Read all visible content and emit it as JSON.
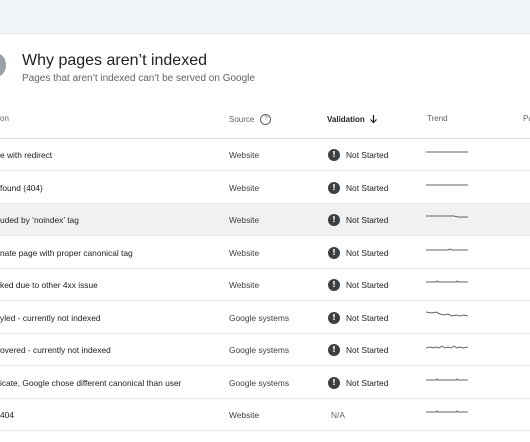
{
  "header": {
    "title": "Why pages aren’t indexed",
    "subtitle": "Pages that aren’t indexed can’t be served on Google"
  },
  "table": {
    "columns": {
      "reason": "on",
      "source": "Source",
      "validation": "Validation",
      "trend": "Trend",
      "pages": "Pa"
    },
    "rows": [
      {
        "reason": "e with redirect",
        "source": "Website",
        "validation": "Not Started",
        "validation_icon": "warning-icon",
        "trend_shape": "flat"
      },
      {
        "reason": "found (404)",
        "source": "Website",
        "validation": "Not Started",
        "validation_icon": "warning-icon",
        "trend_shape": "flat"
      },
      {
        "reason": "uded by ‘noindex’ tag",
        "source": "Website",
        "validation": "Not Started",
        "validation_icon": "warning-icon",
        "trend_shape": "slight-drop",
        "highlighted": true
      },
      {
        "reason": "nate page with proper canonical tag",
        "source": "Website",
        "validation": "Not Started",
        "validation_icon": "warning-icon",
        "trend_shape": "flat-blip"
      },
      {
        "reason": "ked due to other 4xx issue",
        "source": "Website",
        "validation": "Not Started",
        "validation_icon": "warning-icon",
        "trend_shape": "flat-ticks"
      },
      {
        "reason": "yled - currently not indexed",
        "source": "Google systems",
        "validation": "Not Started",
        "validation_icon": "warning-icon",
        "trend_shape": "declining"
      },
      {
        "reason": "overed - currently not indexed",
        "source": "Google systems",
        "validation": "Not Started",
        "validation_icon": "warning-icon",
        "trend_shape": "noisy"
      },
      {
        "reason": "icate, Google chose different canonical than user",
        "source": "Google systems",
        "validation": "Not Started",
        "validation_icon": "warning-icon",
        "trend_shape": "flat-ticks"
      },
      {
        "reason": "404",
        "source": "Website",
        "validation": "N/A",
        "validation_icon": "",
        "trend_shape": "flat-ticks"
      }
    ]
  },
  "colors": {
    "topband": "#f1f4f9",
    "highlight_row": "#f1f1f1",
    "status_icon": "#3c4043",
    "trend_line": "#5f6368"
  }
}
